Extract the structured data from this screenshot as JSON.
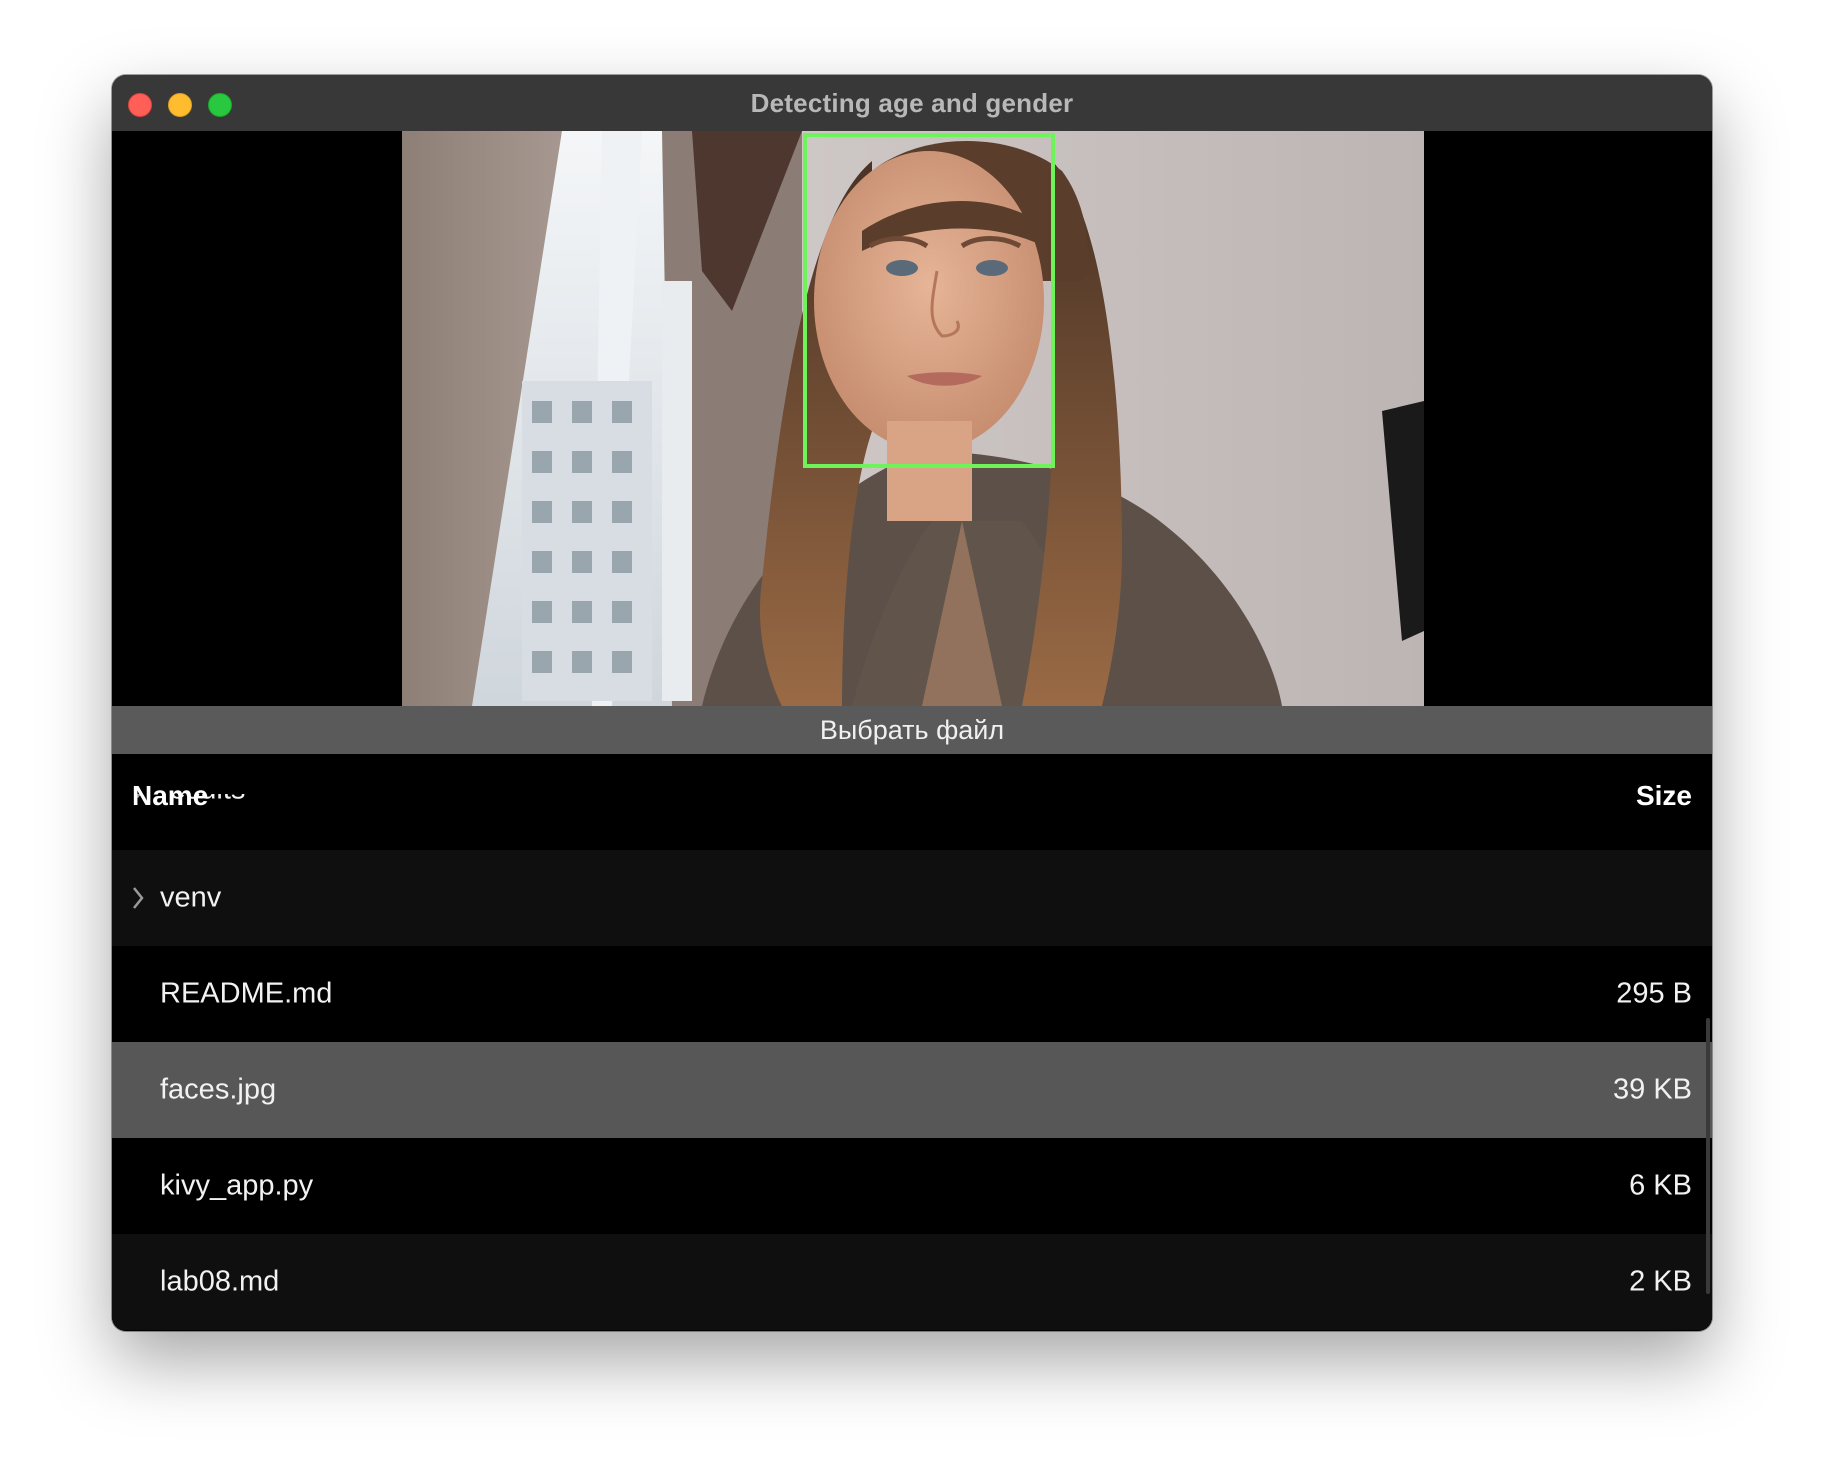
{
  "window": {
    "title": "Detecting age and gender"
  },
  "preview": {
    "face_box_color": "#6ff35a"
  },
  "choose_button": {
    "label": "Выбрать файл"
  },
  "file_list": {
    "columns": {
      "name": "Name",
      "size": "Size"
    },
    "rows": [
      {
        "name": "results",
        "size": "",
        "type": "folder",
        "expanded": true
      },
      {
        "name": "venv",
        "size": "",
        "type": "folder",
        "expanded": false
      },
      {
        "name": "README.md",
        "size": "295 B",
        "type": "file"
      },
      {
        "name": "faces.jpg",
        "size": "39 KB",
        "type": "file",
        "selected": true
      },
      {
        "name": "kivy_app.py",
        "size": "6 KB",
        "type": "file"
      },
      {
        "name": "lab08.md",
        "size": "2 KB",
        "type": "file"
      }
    ]
  },
  "colors": {
    "titlebar": "#383838",
    "selected_row": "#575757",
    "button": "#5a5a5a"
  }
}
